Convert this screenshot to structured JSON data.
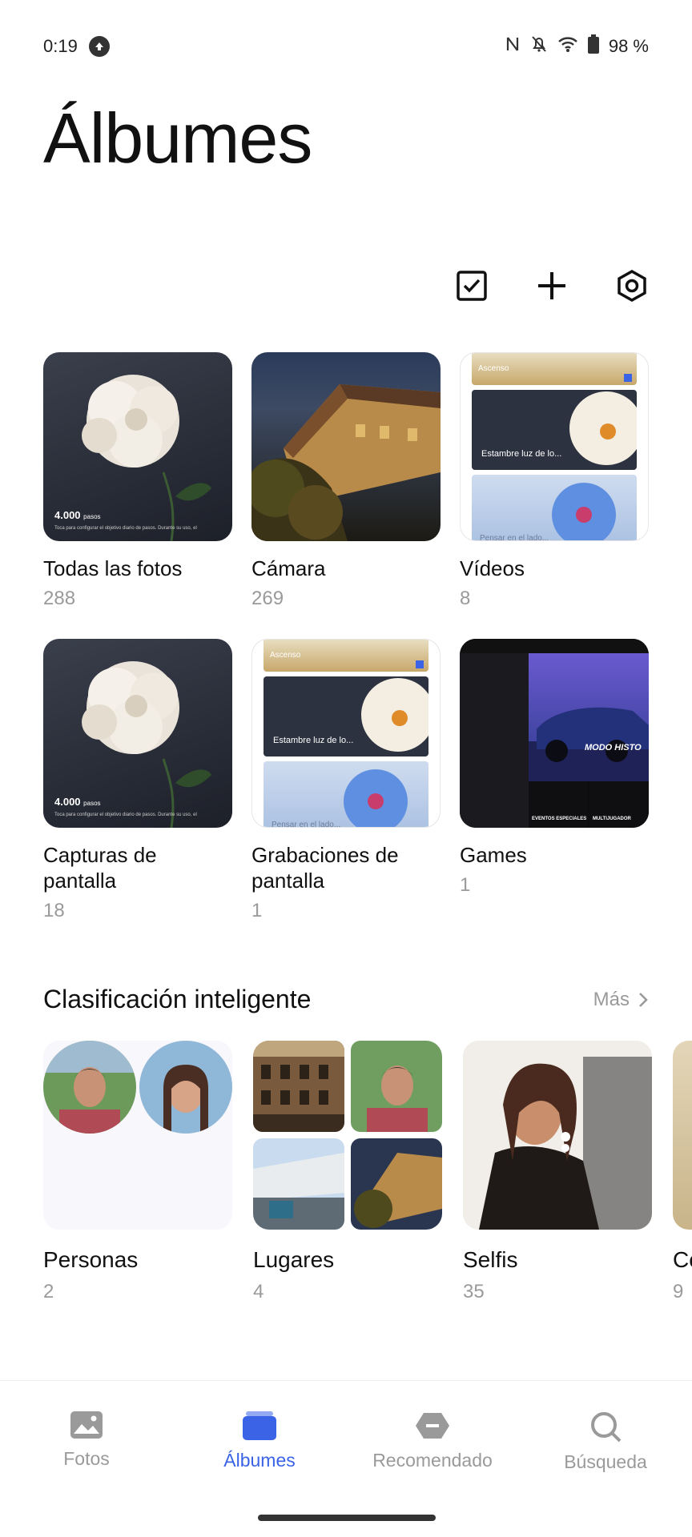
{
  "status_bar": {
    "time": "0:19",
    "battery": "98 %"
  },
  "page_title": "Álbumes",
  "albums": [
    {
      "name": "Todas las fotos",
      "count": "288"
    },
    {
      "name": "Cámara",
      "count": "269"
    },
    {
      "name": "Vídeos",
      "count": "8"
    },
    {
      "name": "Capturas de pantalla",
      "count": "18"
    },
    {
      "name": "Grabaciones de pantalla",
      "count": "1"
    },
    {
      "name": "Games",
      "count": "1"
    }
  ],
  "screenshot_thumb": {
    "steps": "4.000",
    "steps_unit": "pasos",
    "caption": "Toca para configurar el objetivo diario de pasos. Durante su uso, el"
  },
  "video_thumb": {
    "top_label": "Ascenso",
    "mid_label": "Estambre luz de lo...",
    "bottom_label": "Pensar en el lado..."
  },
  "games_thumb": {
    "banner": "MODO HISTO",
    "events": "EVENTOS ESPECIALES",
    "multi": "MULTIJUGADOR"
  },
  "smart_section": {
    "title": "Clasificación inteligente",
    "more_label": "Más",
    "items": [
      {
        "name": "Personas",
        "count": "2"
      },
      {
        "name": "Lugares",
        "count": "4"
      },
      {
        "name": "Selfis",
        "count": "35"
      },
      {
        "name": "Co",
        "count": "9"
      }
    ]
  },
  "bottom_nav": [
    {
      "label": "Fotos",
      "icon": "image-icon",
      "active": false
    },
    {
      "label": "Álbumes",
      "icon": "album-icon",
      "active": true
    },
    {
      "label": "Recomendado",
      "icon": "tag-icon",
      "active": false
    },
    {
      "label": "Búsqueda",
      "icon": "search-icon",
      "active": false
    }
  ],
  "colors": {
    "accent": "#3b63e6",
    "muted": "#9a9a9a"
  }
}
